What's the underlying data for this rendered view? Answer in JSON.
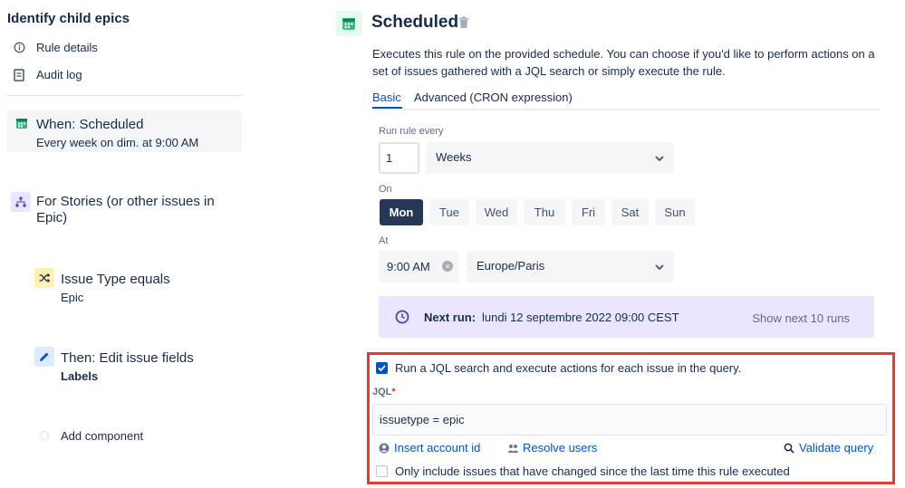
{
  "sidebar": {
    "rule_title": "Identify child epics",
    "nav": [
      {
        "label": "Rule details",
        "icon": "info-icon"
      },
      {
        "label": "Audit log",
        "icon": "document-icon"
      }
    ],
    "trigger": {
      "title": "When: Scheduled",
      "subtitle": "Every week on dim. at 9:00 AM",
      "icon": "calendar-icon"
    },
    "branch": {
      "title_line1": "For Stories (or other issues in",
      "title_line2": "Epic)",
      "icon": "hierarchy-icon"
    },
    "condition": {
      "title": "Issue Type equals",
      "subtitle": "Epic",
      "icon": "shuffle-icon"
    },
    "action": {
      "title": "Then: Edit issue fields",
      "subtitle": "Labels",
      "icon": "pencil-icon"
    },
    "add_component": "Add component"
  },
  "main": {
    "title": "Scheduled",
    "description": "Executes this rule on the provided schedule. You can choose if you'd like to perform actions on a set of issues gathered with a JQL search or simply execute the rule.",
    "tabs": [
      {
        "label": "Basic",
        "active": true
      },
      {
        "label": "Advanced (CRON expression)",
        "active": false
      }
    ],
    "run_every_label": "Run rule every",
    "interval_value": "1",
    "interval_unit": "Weeks",
    "on_label": "On",
    "days": [
      {
        "label": "Mon",
        "selected": true
      },
      {
        "label": "Tue",
        "selected": false
      },
      {
        "label": "Wed",
        "selected": false
      },
      {
        "label": "Thu",
        "selected": false
      },
      {
        "label": "Fri",
        "selected": false
      },
      {
        "label": "Sat",
        "selected": false
      },
      {
        "label": "Sun",
        "selected": false
      }
    ],
    "at_label": "At",
    "time_value": "9:00 AM",
    "timezone": "Europe/Paris",
    "next_run": {
      "label": "Next run:",
      "value": "lundi 12 septembre 2022 09:00 CEST",
      "show_more": "Show next 10 runs"
    },
    "jql_section": {
      "run_jql_checkbox_label": "Run a JQL search and execute actions for each issue in the query.",
      "run_jql_checked": true,
      "jql_label": "JQL",
      "required_marker": "*",
      "jql_value": "issuetype = epic",
      "insert_account_id": "Insert account id",
      "resolve_users": "Resolve users",
      "validate_query": "Validate query",
      "only_changed_label": "Only include issues that have changed since the last time this rule executed",
      "only_changed_checked": false
    }
  },
  "colors": {
    "accent": "#0052cc",
    "selected_day": "#253858",
    "next_run_bg": "#eae6ff",
    "highlight_border": "#e53a2f"
  }
}
